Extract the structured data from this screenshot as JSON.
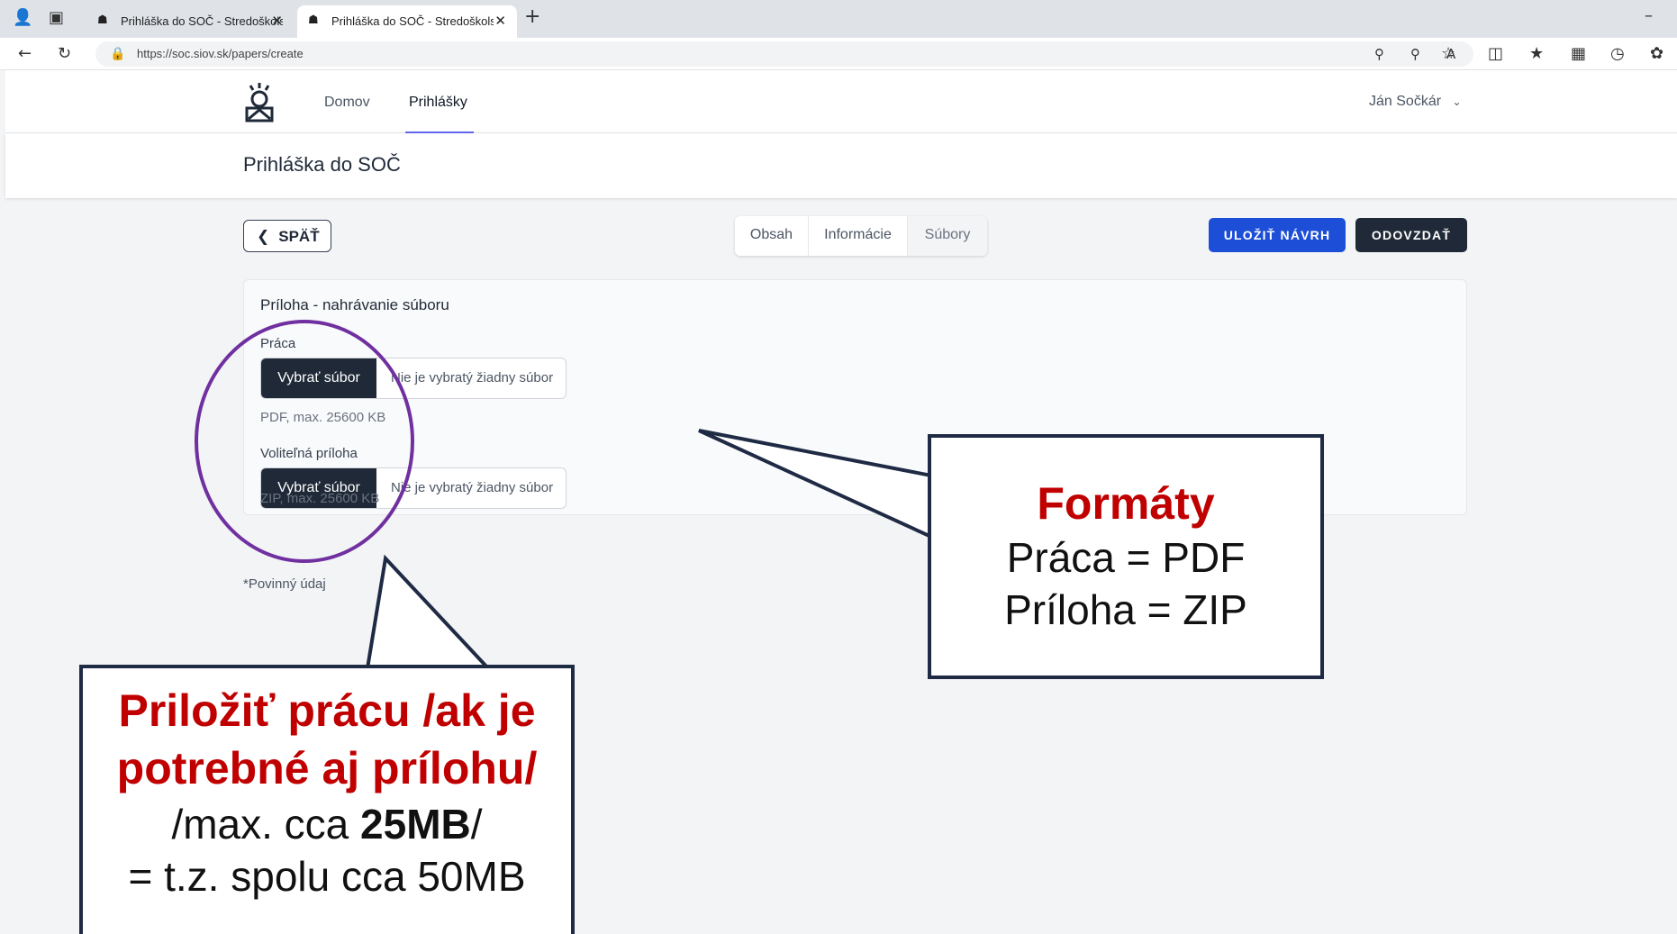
{
  "browser": {
    "tabs": [
      {
        "title": "Prihláška do SOČ - Stredoškolská"
      },
      {
        "title": "Prihláška do SOČ - Stredoškolská"
      }
    ],
    "url": "https://soc.siov.sk/papers/create"
  },
  "nav": {
    "home": "Domov",
    "applications": "Prihlášky",
    "user": "Ján Sočkár"
  },
  "header": {
    "title": "Prihláška do SOČ"
  },
  "toolbar": {
    "back": "SPÄŤ",
    "tabs": [
      "Obsah",
      "Informácie",
      "Súbory"
    ],
    "save_draft": "ULOŽIŤ NÁVRH",
    "submit": "ODOVZDAŤ"
  },
  "upload": {
    "title": "Príloha - nahrávanie súboru",
    "fields": [
      {
        "label": "Práca",
        "button": "Vybrať súbor",
        "status": "Nie je vybratý žiadny súbor",
        "hint": "PDF, max. 25600 KB"
      },
      {
        "label": "Voliteľná príloha",
        "button": "Vybrať súbor",
        "status": "Nie je vybratý žiadny súbor",
        "hint": "ZIP, max. 25600 KB"
      }
    ],
    "required_note": "*Povinný údaj"
  },
  "callouts": {
    "formats": {
      "title": "Formáty",
      "line1": "Práca = PDF",
      "line2": "Príloha = ZIP"
    },
    "attach": {
      "line1": "Priložiť prácu /ak je",
      "line2": "potrebné aj prílohu/",
      "line3_prefix": "/max. cca ",
      "line3_bold": "25MB",
      "line3_suffix": "/",
      "line4": "= t.z. spolu cca 50MB"
    }
  },
  "colors": {
    "primary": "#1d4ed8",
    "dark": "#1f2937",
    "highlight_circle": "#7030a0",
    "callout_red": "#c00000"
  }
}
